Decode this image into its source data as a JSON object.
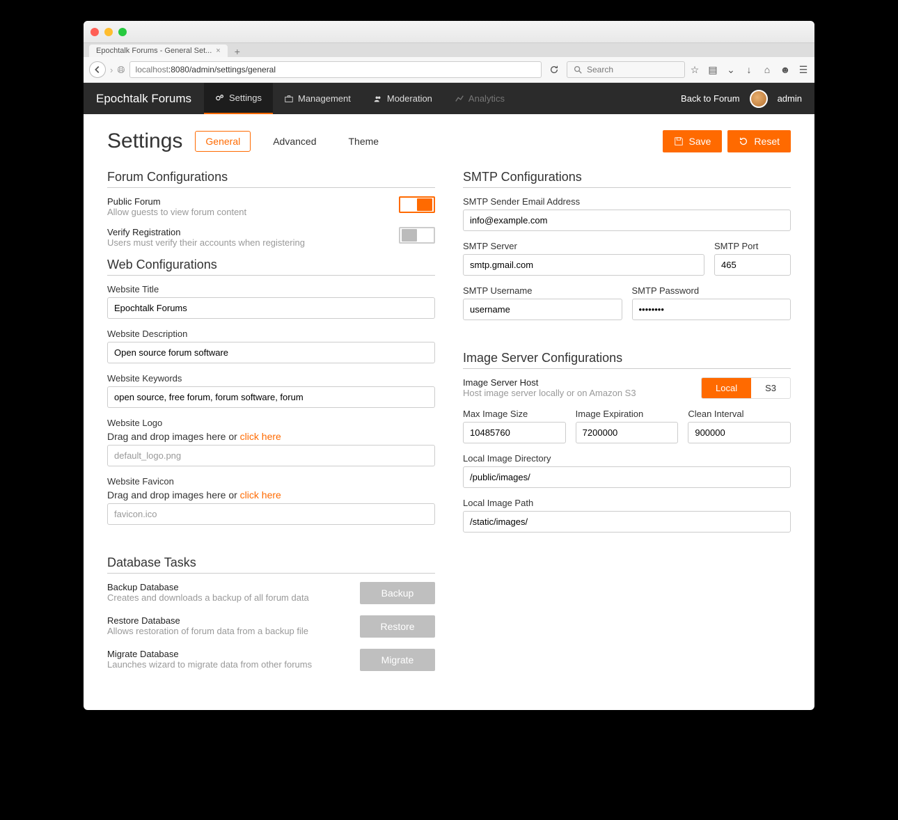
{
  "browser": {
    "tab_title": "Epochtalk Forums - General Set...",
    "url_host": "localhost",
    "url_rest": ":8080/admin/settings/general",
    "search_placeholder": "Search"
  },
  "admin_nav": {
    "brand": "Epochtalk Forums",
    "items": [
      "Settings",
      "Management",
      "Moderation",
      "Analytics"
    ],
    "back": "Back to Forum",
    "user": "admin"
  },
  "page": {
    "title": "Settings",
    "subtabs": [
      "General",
      "Advanced",
      "Theme"
    ],
    "save": "Save",
    "reset": "Reset"
  },
  "forum_config": {
    "heading": "Forum Configurations",
    "public_label": "Public Forum",
    "public_sub": "Allow guests to view forum content",
    "public_on": true,
    "verify_label": "Verify Registration",
    "verify_sub": "Users must verify their accounts when registering",
    "verify_on": false
  },
  "web_config": {
    "heading": "Web Configurations",
    "title_label": "Website Title",
    "title_value": "Epochtalk Forums",
    "desc_label": "Website Description",
    "desc_value": "Open source forum software",
    "keywords_label": "Website Keywords",
    "keywords_value": "open source, free forum, forum software, forum",
    "logo_label": "Website Logo",
    "drag_text": "Drag and drop images here or ",
    "drag_link": "click here",
    "logo_value": "default_logo.png",
    "favicon_label": "Website Favicon",
    "favicon_value": "favicon.ico"
  },
  "db": {
    "heading": "Database Tasks",
    "backup_label": "Backup Database",
    "backup_sub": "Creates and downloads a backup of all forum data",
    "backup_btn": "Backup",
    "restore_label": "Restore Database",
    "restore_sub": "Allows restoration of forum data from a backup file",
    "restore_btn": "Restore",
    "migrate_label": "Migrate Database",
    "migrate_sub": "Launches wizard to migrate data from other forums",
    "migrate_btn": "Migrate"
  },
  "smtp": {
    "heading": "SMTP Configurations",
    "sender_label": "SMTP Sender Email Address",
    "sender_value": "info@example.com",
    "server_label": "SMTP Server",
    "server_value": "smtp.gmail.com",
    "port_label": "SMTP Port",
    "port_value": "465",
    "user_label": "SMTP Username",
    "user_value": "username",
    "pass_label": "SMTP Password",
    "pass_value": "••••••••"
  },
  "img": {
    "heading": "Image Server Configurations",
    "host_label": "Image Server Host",
    "host_sub": "Host image server locally or on Amazon S3",
    "seg_local": "Local",
    "seg_s3": "S3",
    "max_label": "Max Image Size",
    "max_value": "10485760",
    "exp_label": "Image Expiration",
    "exp_value": "7200000",
    "clean_label": "Clean Interval",
    "clean_value": "900000",
    "dir_label": "Local Image Directory",
    "dir_value": "/public/images/",
    "path_label": "Local Image Path",
    "path_value": "/static/images/"
  }
}
